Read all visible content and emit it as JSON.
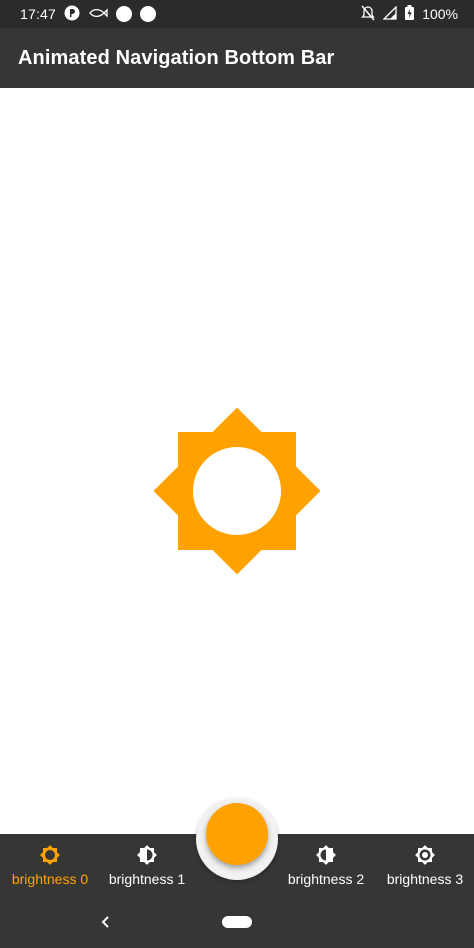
{
  "status_bar": {
    "time": "17:47",
    "battery": "100%",
    "icons": [
      "notification-app-icon",
      "fish-icon",
      "circle-icon",
      "circle-icon",
      "mute-icon",
      "signal-icon",
      "battery-icon"
    ]
  },
  "app_bar": {
    "title": "Animated Navigation Bottom Bar"
  },
  "main": {
    "icon": "brightness-sun-icon",
    "accent_color": "#ffa200"
  },
  "bottom_nav": {
    "active_index": 0,
    "items": [
      {
        "label": "brightness 0",
        "icon": "brightness-0-icon"
      },
      {
        "label": "brightness 1",
        "icon": "brightness-1-icon"
      },
      {
        "label": "brightness 2",
        "icon": "brightness-2-icon"
      },
      {
        "label": "brightness 3",
        "icon": "brightness-3-icon"
      }
    ],
    "fab_icon": "moon-icon"
  },
  "colors": {
    "bar": "#363735",
    "status": "#2b2c2a",
    "accent": "#ffa200",
    "white": "#ffffff"
  }
}
